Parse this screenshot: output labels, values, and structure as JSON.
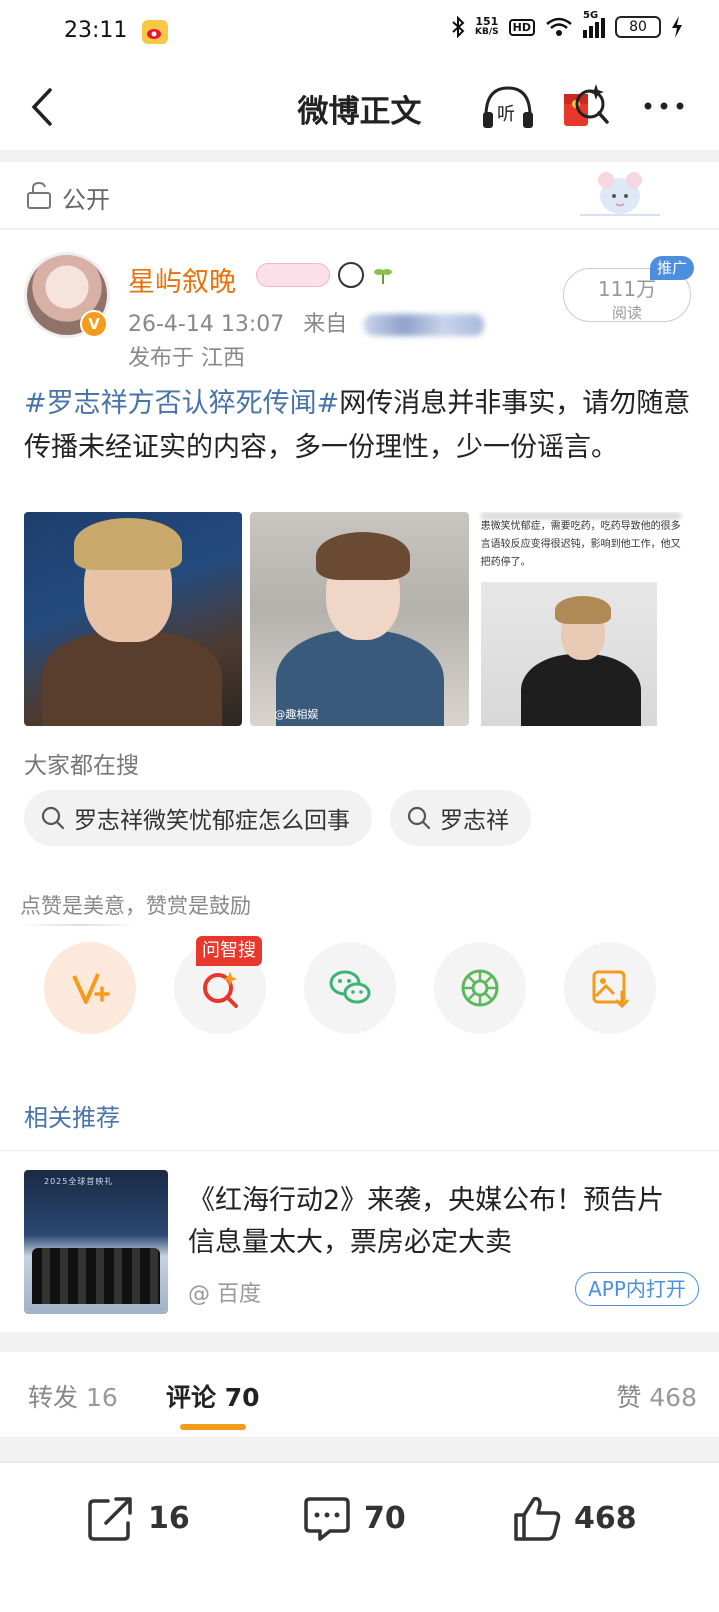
{
  "status_bar": {
    "time": "23:11",
    "net_speed_value": "151",
    "net_speed_unit": "KB/S",
    "hd_label": "HD",
    "signal_label": "5G",
    "battery": "80",
    "icons": [
      "weibo-icon",
      "bluetooth-icon",
      "wifi-icon",
      "signal-icon",
      "battery-icon",
      "charging-icon"
    ]
  },
  "nav": {
    "title": "微博正文",
    "icons": [
      "back-icon",
      "listen-icon",
      "red-packet-search-icon",
      "more-icon"
    ]
  },
  "visibility": {
    "label": "公开"
  },
  "post": {
    "author": "星屿叙晚",
    "timestamp": "26-4-14 13:07",
    "source_prefix": "来自",
    "location": "发布于 江西",
    "reads_count": "111万",
    "reads_label": "阅读",
    "promo_tag": "推广",
    "hashtag": "#罗志祥方否认猝死传闻#",
    "text": "网传消息并非事实，请勿随意传播未经证实的内容，多一份理性，少一份谣言。",
    "image2_watermark": "@趣相娱",
    "image3_caption": "患微笑忧郁症，需要吃药，吃药导致他的很多言语较反应变得很迟钝，影响到他工作，他又把药停了。"
  },
  "hot_search": {
    "label": "大家都在搜",
    "chips": [
      "罗志祥微笑忧郁症怎么回事",
      "罗志祥"
    ]
  },
  "reward": {
    "label": "点赞是美意，赞赏是鼓励",
    "ask_tag": "问智搜",
    "buttons": [
      "reward-v-plus-icon",
      "ask-search-icon",
      "wechat-icon",
      "moments-icon",
      "save-image-icon"
    ]
  },
  "related": {
    "heading": "相关推荐",
    "thumb_text": "2025全球首映礼",
    "headline": "《红海行动2》来袭，央媒公布！预告片信息量太大，票房必定大卖",
    "source": "@ 百度",
    "open_button": "APP内打开"
  },
  "tabs": [
    {
      "label": "转发",
      "count": "16"
    },
    {
      "label": "评论",
      "count": "70"
    },
    {
      "label": "赞",
      "count": "468"
    }
  ],
  "bottom_bar": {
    "repost_count": "16",
    "comment_count": "70",
    "like_count": "468"
  },
  "colors": {
    "username": "#e8730c",
    "hashtag": "#4874a8",
    "accent_orange": "#f49b1b",
    "promo_blue": "#4c8fe0",
    "ask_red": "#e8382b"
  }
}
